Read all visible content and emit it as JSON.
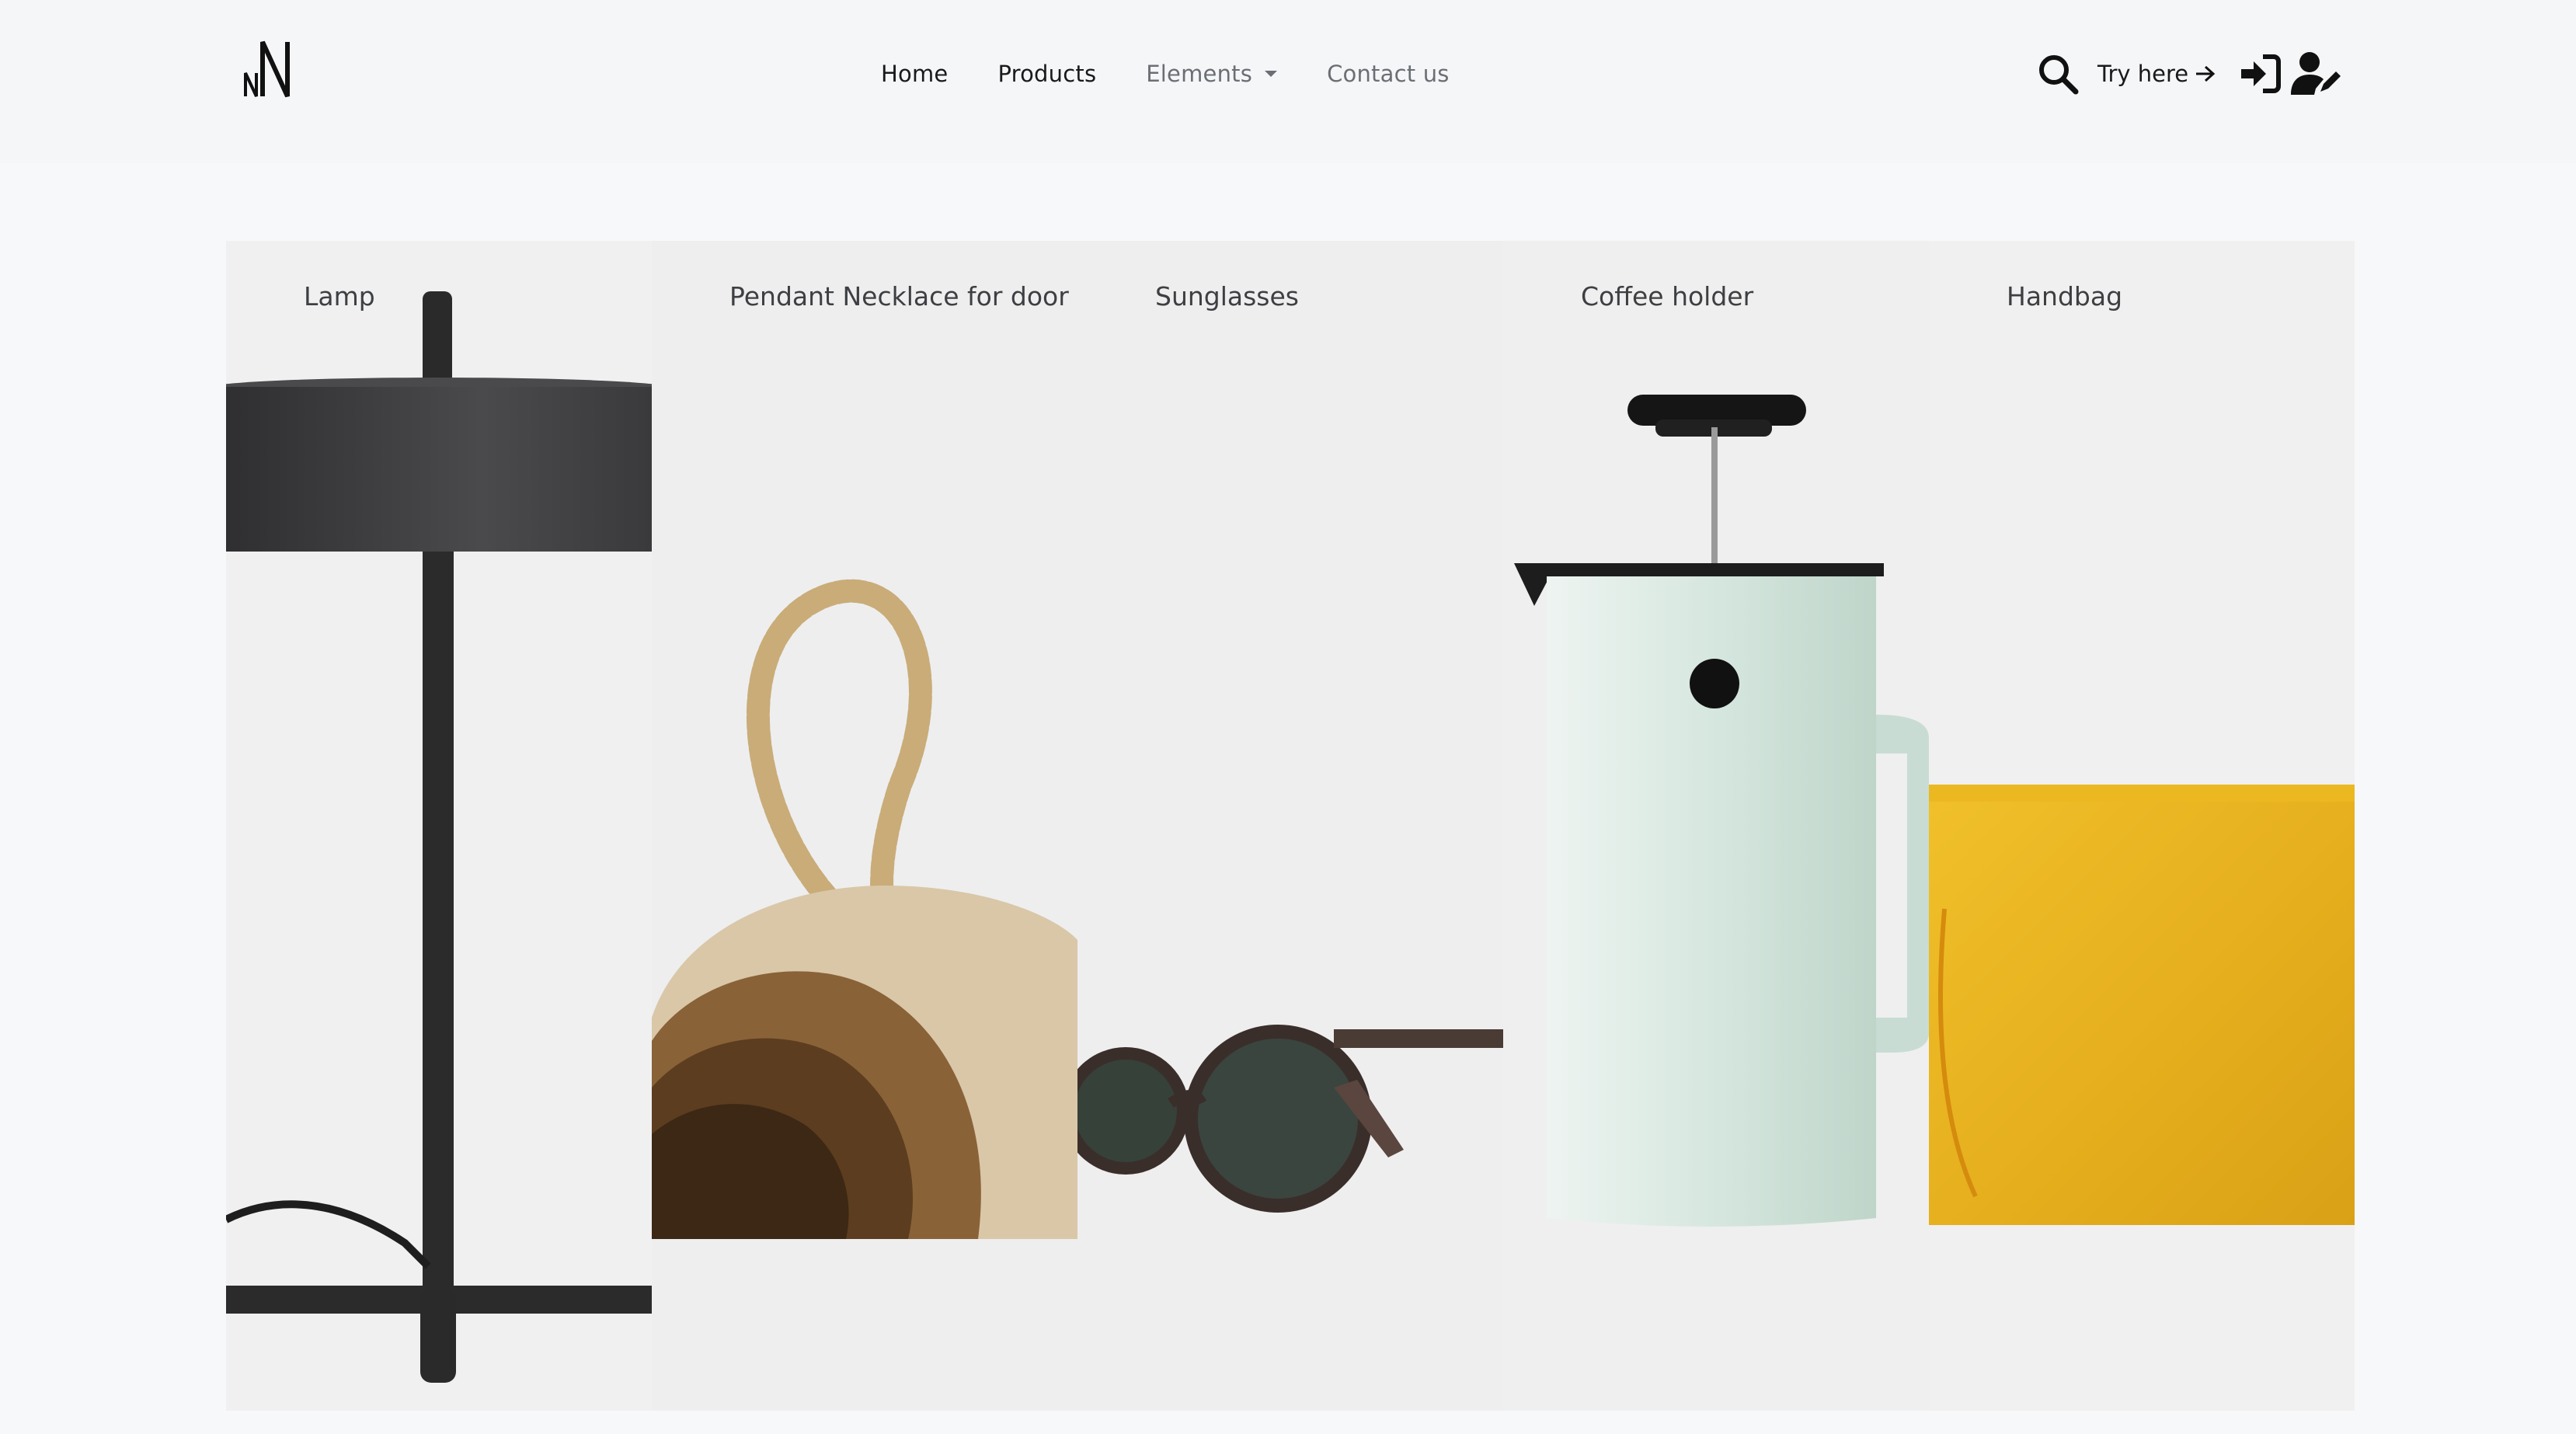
{
  "header": {
    "nav": [
      {
        "label": "Home"
      },
      {
        "label": "Products"
      },
      {
        "label": "Elements"
      },
      {
        "label": "Contact us"
      }
    ],
    "try_label": "Try here",
    "icons": [
      "brand-logo",
      "search-icon",
      "arrow-right-icon",
      "sign-in-icon",
      "user-edit-icon",
      "chevron-down-icon"
    ]
  },
  "products": [
    {
      "label": "Lamp",
      "icon": "lamp-image"
    },
    {
      "label": "Pendant Necklace for door",
      "icon": "door-stop-image"
    },
    {
      "label": "Sunglasses",
      "icon": "sunglasses-image"
    },
    {
      "label": "Coffee holder",
      "icon": "coffee-press-image"
    },
    {
      "label": "Handbag",
      "icon": "handbag-image"
    }
  ],
  "colors": {
    "background": "#f7f8fa",
    "tile": "#efeff0",
    "handbag": "#e8b21f",
    "coffee_press": "#d9e8e0",
    "text": "#1a1a1a"
  }
}
